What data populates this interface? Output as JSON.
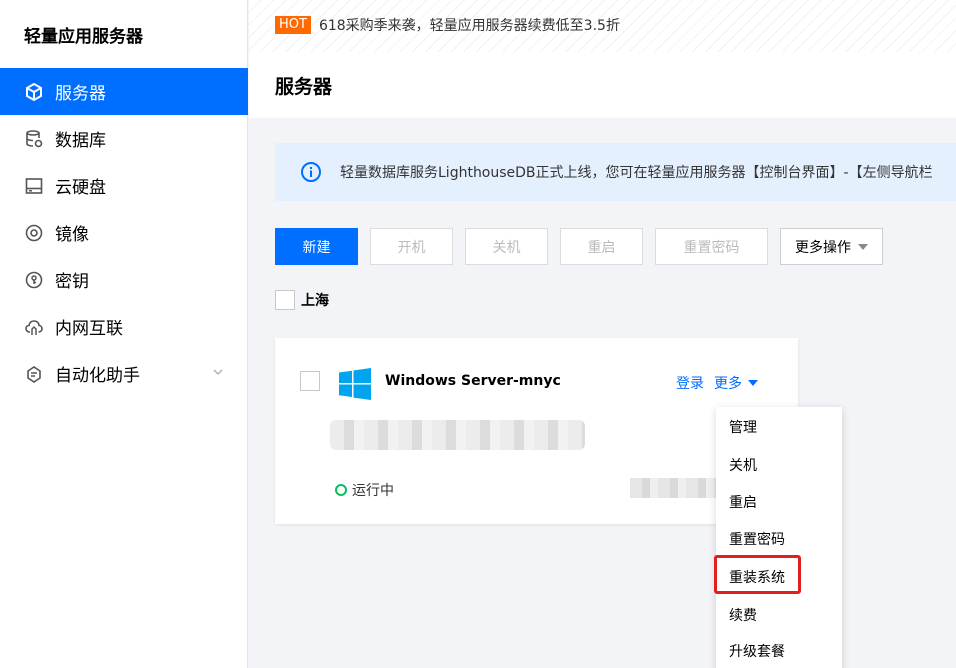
{
  "sidebar": {
    "title": "轻量应用服务器",
    "items": [
      {
        "label": "服务器",
        "icon": "cube-icon",
        "active": true
      },
      {
        "label": "数据库",
        "icon": "database-icon"
      },
      {
        "label": "云硬盘",
        "icon": "disk-icon"
      },
      {
        "label": "镜像",
        "icon": "image-disc-icon"
      },
      {
        "label": "密钥",
        "icon": "key-icon"
      },
      {
        "label": "内网互联",
        "icon": "cloud-link-icon"
      },
      {
        "label": "自动化助手",
        "icon": "automation-icon",
        "has_children": true
      }
    ]
  },
  "banner": {
    "badge": "HOT",
    "text": "618采购季来袭，轻量应用服务器续费低至3.5折"
  },
  "page": {
    "title": "服务器"
  },
  "notice": {
    "text": "轻量数据库服务LighthouseDB正式上线，您可在轻量应用服务器【控制台界面】-【左侧导航栏"
  },
  "toolbar": {
    "new": "新建",
    "start": "开机",
    "shutdown": "关机",
    "restart": "重启",
    "reset_password": "重置密码",
    "more_actions": "更多操作"
  },
  "region": {
    "label": "上海"
  },
  "server": {
    "name": "Windows Server-mnyc",
    "login": "登录",
    "more": "更多",
    "status": "运行中"
  },
  "dropdown": {
    "items": [
      "管理",
      "关机",
      "重启",
      "重置密码",
      "重装系统",
      "续费",
      "升级套餐"
    ],
    "highlighted": "重装系统"
  },
  "colors": {
    "primary": "#006eff",
    "hot": "#ff6a00",
    "running": "#0abf5b",
    "highlight": "#e02020"
  }
}
